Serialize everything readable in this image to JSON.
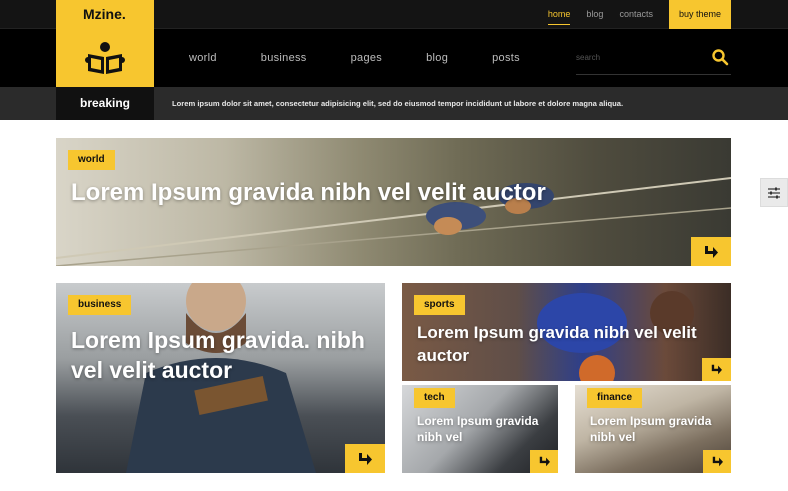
{
  "site": {
    "name": "Mzine."
  },
  "topnav": {
    "items": [
      {
        "label": "home",
        "active": true
      },
      {
        "label": "blog",
        "active": false
      },
      {
        "label": "contacts",
        "active": false
      }
    ],
    "cta_label": "buy theme"
  },
  "mainnav": {
    "items": [
      "world",
      "business",
      "pages",
      "blog",
      "posts"
    ]
  },
  "search": {
    "placeholder": "search"
  },
  "breaking": {
    "label": "breaking",
    "text": "Lorem ipsum dolor sit amet, consectetur adipisicing elit, sed do eiusmod tempor incididunt ut labore et dolore magna aliqua."
  },
  "cards": {
    "world": {
      "tag": "world",
      "title": "Lorem Ipsum gravida nibh vel velit auctor"
    },
    "business": {
      "tag": "business",
      "title": "Lorem Ipsum gravida. nibh vel velit auctor"
    },
    "sports": {
      "tag": "sports",
      "title": "Lorem Ipsum gravida nibh vel velit auctor"
    },
    "tech": {
      "tag": "tech",
      "title": "Lorem Ipsum gravida nibh vel"
    },
    "finance": {
      "tag": "finance",
      "title": "Lorem Ipsum gravida nibh vel"
    }
  },
  "colors": {
    "accent": "#f7c62f",
    "dark": "#000000",
    "breaking_bg": "#2b2b2b"
  },
  "icons": {
    "logo": "book-reader-icon",
    "search": "search-icon",
    "arrow": "arrow-turn-right-icon",
    "settings": "sliders-icon"
  }
}
